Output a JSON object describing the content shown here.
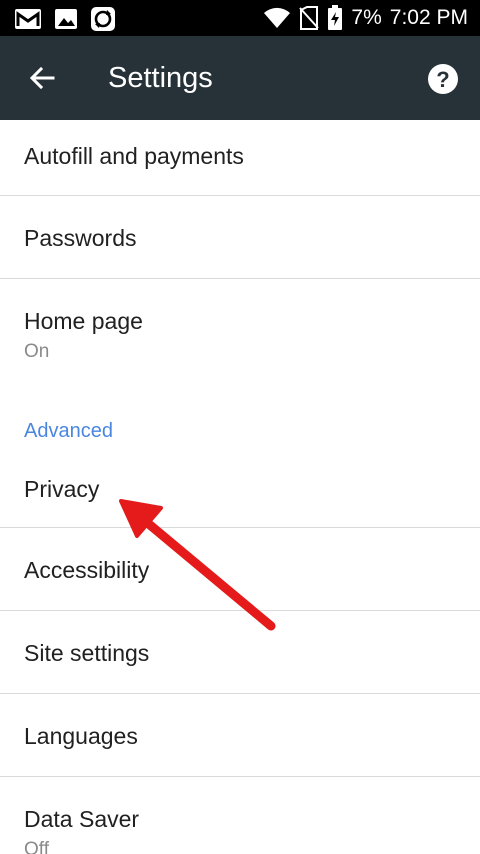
{
  "status_bar": {
    "icons_left": [
      "gmail-icon",
      "image-icon",
      "sync-icon"
    ],
    "icons_right": [
      "wifi-icon",
      "no-sim-icon",
      "battery-charging-icon"
    ],
    "battery": "7%",
    "time": "7:02 PM"
  },
  "app_bar": {
    "back_icon": "arrow-back-icon",
    "title": "Settings",
    "help_icon": "help-icon",
    "background": "#263238"
  },
  "list": {
    "items": [
      {
        "label": "Autofill and payments"
      },
      {
        "label": "Passwords"
      },
      {
        "label": "Home page",
        "sub": "On"
      },
      {
        "section": "Advanced"
      },
      {
        "label": "Privacy"
      },
      {
        "label": "Accessibility"
      },
      {
        "label": "Site settings"
      },
      {
        "label": "Languages"
      },
      {
        "label": "Data Saver",
        "sub": "Off"
      }
    ]
  },
  "colors": {
    "section_header": "#4a86e0",
    "annotation_arrow": "#e51b1b"
  }
}
